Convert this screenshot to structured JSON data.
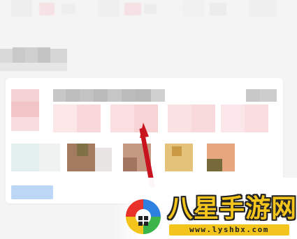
{
  "watermark": {
    "title": "八星手游网",
    "url": "www.lyshbx.com"
  },
  "icons": {
    "pointer": "red-arrow-pointer-icon",
    "logo": "colorful-ring-logo-icon"
  },
  "colors": {
    "arrow": "#c8141e",
    "accent_blue": "#bcd6f6",
    "watermark_yellow": "#f3c51c"
  }
}
